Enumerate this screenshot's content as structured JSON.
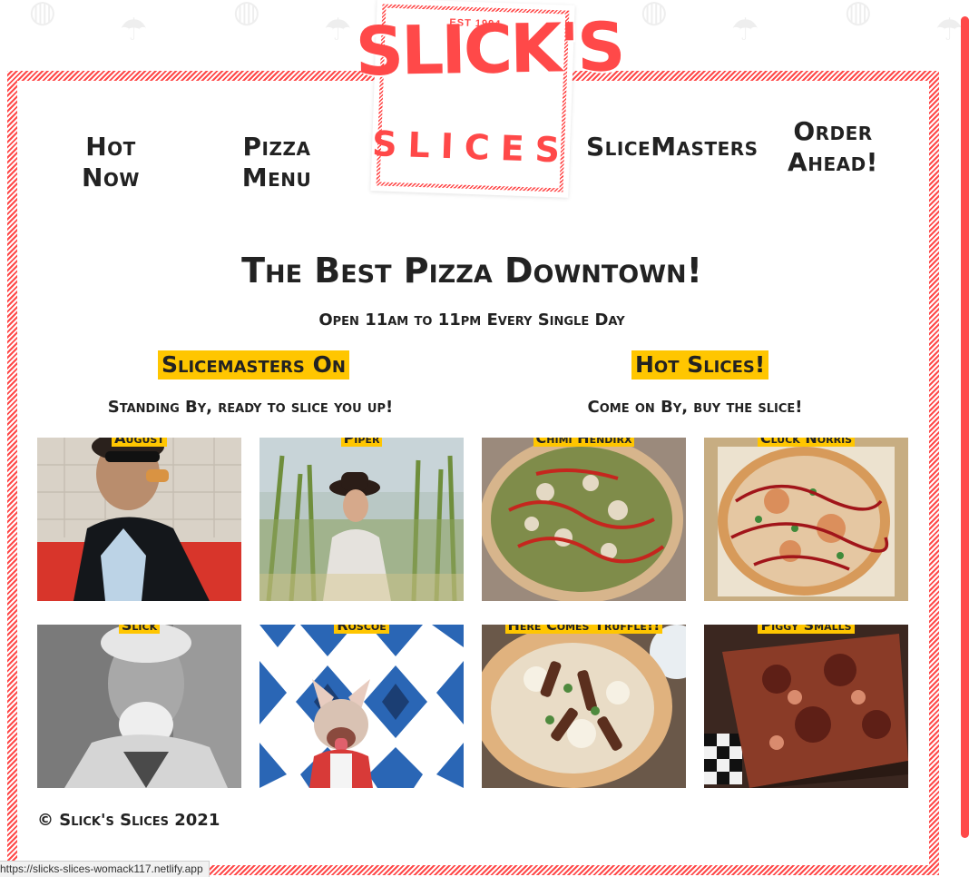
{
  "logo": {
    "est": "EST 1994",
    "name_top": "SLICK'S",
    "name_bottom": "SLICES"
  },
  "nav": {
    "hot_now": "Hot Now",
    "pizza_menu": "Pizza Menu",
    "slicemasters": "SliceMasters",
    "order_ahead_line1": "Order",
    "order_ahead_line2": "Ahead!"
  },
  "hero": {
    "title": "The Best Pizza Downtown!",
    "hours": "Open 11am to 11pm Every Single Day"
  },
  "slicemasters": {
    "title": "Slicemasters On",
    "subtitle": "Standing By, ready to slice you up!",
    "people": [
      {
        "name": "August"
      },
      {
        "name": "Piper"
      },
      {
        "name": "Slick"
      },
      {
        "name": "Roscoe"
      }
    ]
  },
  "hot_slices": {
    "title": "Hot Slices!",
    "subtitle": "Come on By, buy the slice!",
    "pizzas": [
      {
        "name": "Chimi Hendirx"
      },
      {
        "name": "Cluck Norris"
      },
      {
        "name": "Here Comes Truffle!!"
      },
      {
        "name": "Piggy Smalls"
      }
    ]
  },
  "footer": {
    "copyright": "© Slick's Slices 2021"
  },
  "status_bar": {
    "url": "https://slicks-slices-womack117.netlify.app"
  },
  "colors": {
    "accent": "#ff4949",
    "highlight": "#ffc600",
    "text": "#222222"
  }
}
